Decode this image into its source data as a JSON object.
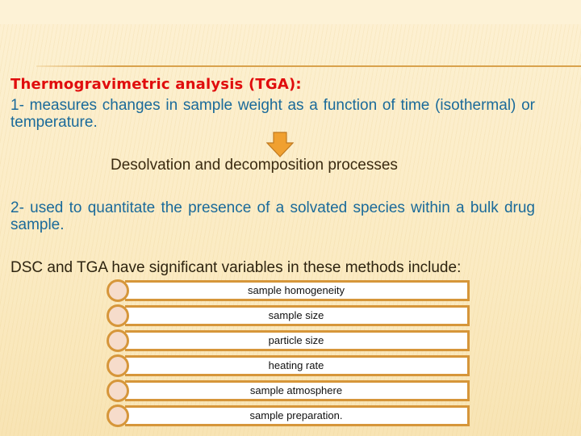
{
  "slide": {
    "heading": "Thermogravimetric analysis (TGA):",
    "point1": "1- measures changes in sample weight as a function of time (isothermal) or temperature.",
    "arrow_icon": "down-arrow-icon",
    "result": "Desolvation and decomposition processes",
    "point2": "2- used to quantitate the presence of a solvated species within a bulk drug sample.",
    "variables_intro": "DSC and TGA have significant variables in these methods include:",
    "variables": [
      "sample homogeneity",
      "sample size",
      "particle size",
      "heating rate",
      "sample atmosphere",
      "sample preparation."
    ]
  },
  "colors": {
    "heading": "#e00d0d",
    "body_text": "#1a6a9a",
    "accent": "#d6963a",
    "arrow": "#f0a030"
  }
}
